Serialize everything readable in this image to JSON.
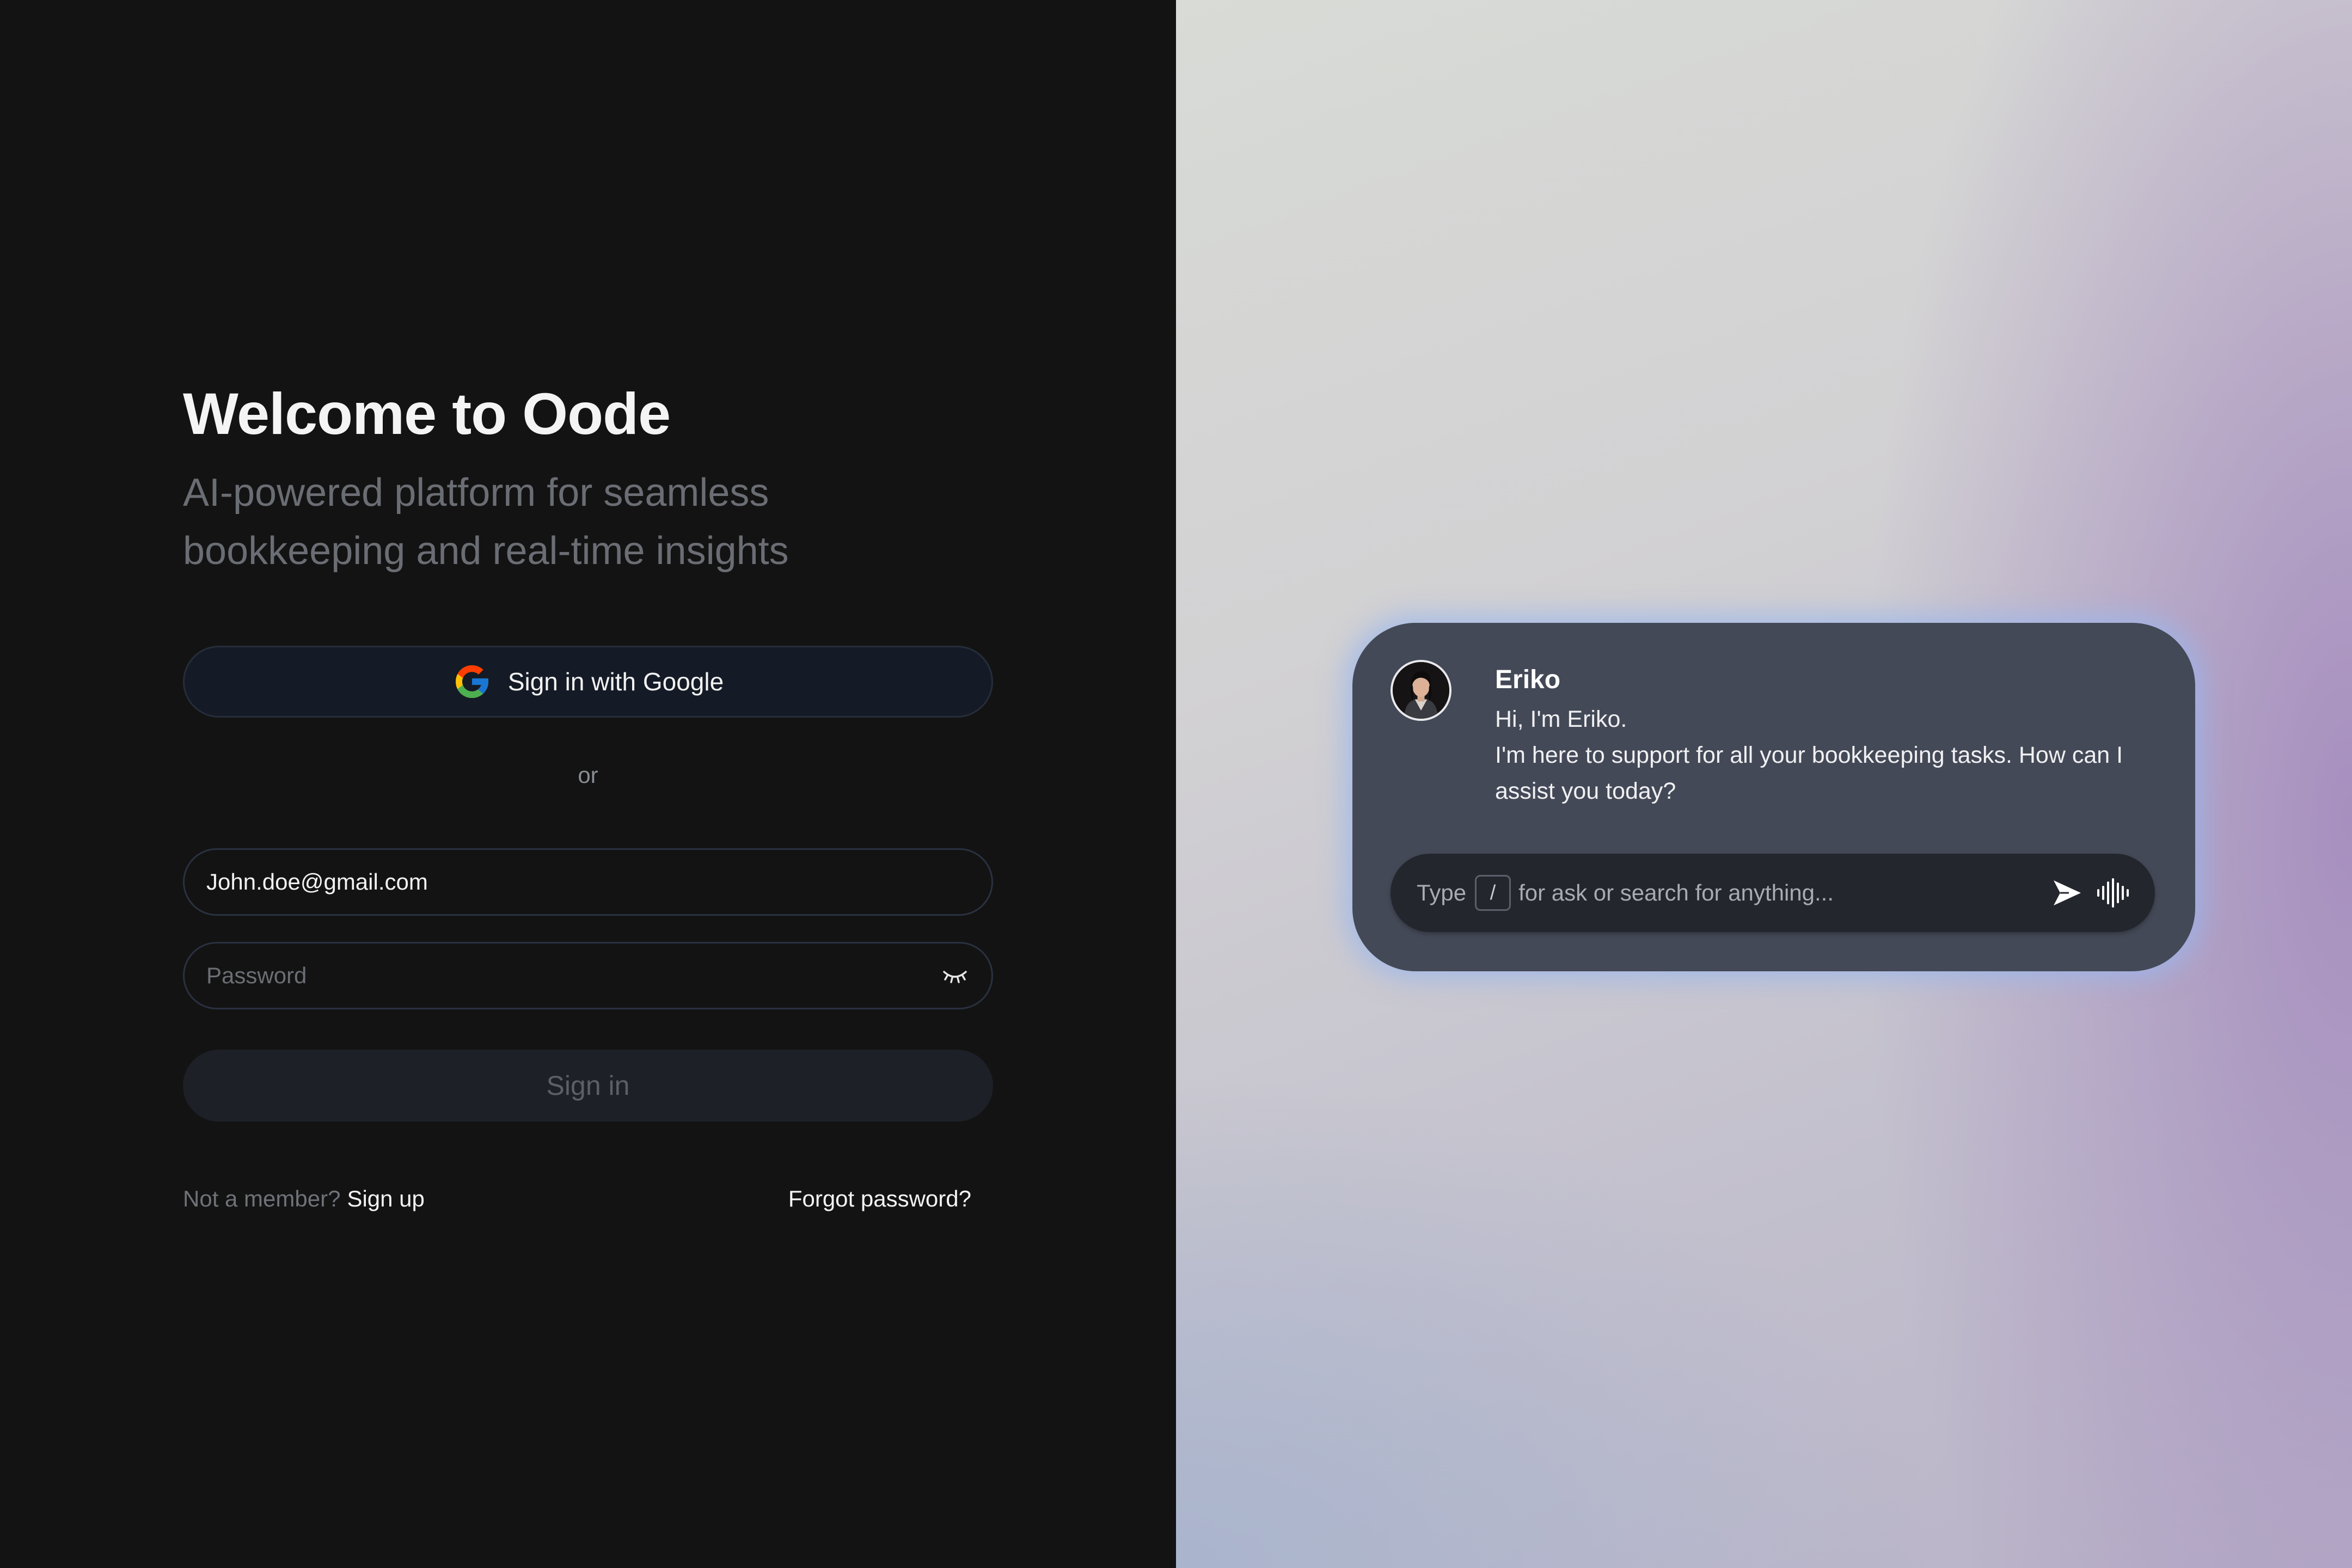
{
  "auth": {
    "title": "Welcome to Oode",
    "subtitle": "AI-powered platform for seamless bookkeeping and real-time insights",
    "google_button_label": "Sign in with Google",
    "divider_label": "or",
    "email_value": "John.doe@gmail.com",
    "password_placeholder": "Password",
    "signin_label": "Sign in",
    "not_member_text": "Not a member?",
    "signup_link": "Sign up",
    "forgot_link": "Forgot password?"
  },
  "assistant": {
    "name": "Eriko",
    "greeting": "Hi, I'm Eriko.",
    "message": "I'm here to support for all your bookkeeping tasks. How can I assist you today?",
    "input_prefix": "Type",
    "input_shortcut": "/",
    "input_suffix": "for ask or search for anything..."
  },
  "icons": {
    "google": "google-g-logo",
    "password_toggle": "closed-eye-icon",
    "send": "send-arrow-icon",
    "voice": "sound-wave-icon"
  },
  "colors": {
    "left_background": "#131313",
    "google_button_bg": "#141b26",
    "signin_button_bg": "#1d2027",
    "chat_card_bg": "#444957",
    "chat_input_bg": "#23262d",
    "card_glow": "#98b6ee"
  }
}
